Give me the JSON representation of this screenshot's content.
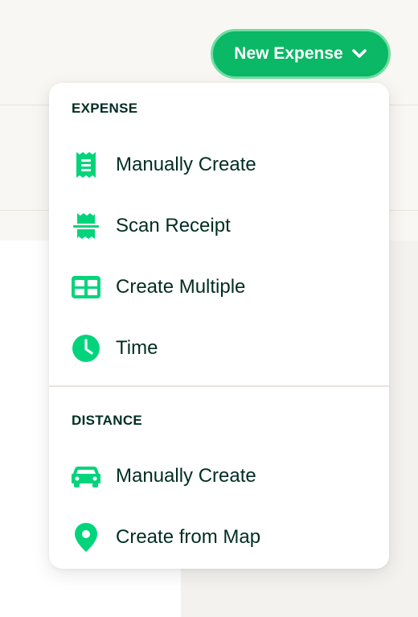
{
  "button": {
    "label": "New Expense"
  },
  "menu": {
    "sections": [
      {
        "header": "EXPENSE",
        "items": [
          {
            "label": "Manually Create",
            "icon": "receipt-icon"
          },
          {
            "label": "Scan Receipt",
            "icon": "scan-receipt-icon"
          },
          {
            "label": "Create Multiple",
            "icon": "table-icon"
          },
          {
            "label": "Time",
            "icon": "clock-icon"
          }
        ]
      },
      {
        "header": "DISTANCE",
        "items": [
          {
            "label": "Manually Create",
            "icon": "car-icon"
          },
          {
            "label": "Create from Map",
            "icon": "map-pin-icon"
          }
        ]
      }
    ]
  },
  "colors": {
    "accent": "#0ab866",
    "accent_ring": "#6fdfa2",
    "icon": "#03d47c",
    "text": "#002e22",
    "background": "#f9f7f3"
  }
}
